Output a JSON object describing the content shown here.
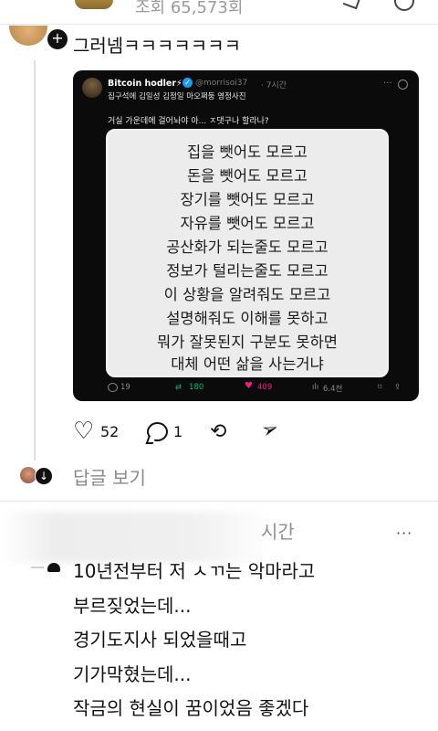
{
  "top": {
    "views": "조회 65,573회"
  },
  "reply1": {
    "text": "그러넴ㅋㅋㅋㅋㅋㅋㅋ",
    "follow_badge": "+",
    "likes": "52",
    "comments": "1",
    "see_replies": "답글 보기",
    "down_badge": "↓"
  },
  "tweet": {
    "name": "Bitcoin hodler⚡",
    "verified": "✓",
    "handle": "@morrisoi37",
    "time": "· 7시간",
    "more": "···",
    "subtitle": "집구석에 김일성 김정일 마오쩌둥 영정사진",
    "body": "거실 가운데에 걸어놔야 아... ㅈ댓구나 할라나?",
    "image_lines": [
      "집을 뺏어도 모르고",
      "돈을 뺏어도 모르고",
      "장기를 뺏어도 모르고",
      "자유를 뺏어도 모르고",
      "공산화가 되는줄도 모르고",
      "정보가 털리는줄도 모르고",
      "이 상황을 알려줘도 모르고",
      "설명해줘도 이해를 못하고",
      "뭐가 잘못된지 구분도 못하면",
      "대체 어떤 삶을 사는거냐"
    ],
    "replies": "19",
    "reposts": "180",
    "likes": "409",
    "views": "6.4천",
    "colors": {
      "repost": "#00ba7c",
      "like": "#f91880",
      "verified": "#1d9bf0"
    }
  },
  "reply2": {
    "time": "시간",
    "more": "···",
    "lines": [
      "10년전부터 저 ㅅㄲ는 악마라고",
      "부르짖었는데...",
      "경기도지사 되었을때고",
      "기가막혔는데...",
      "작금의 현실이 꿈이었음 좋겠다"
    ]
  },
  "icons": {
    "heart": "♡",
    "repost": "⟲",
    "send": "➢",
    "tweet_repost": "⇄",
    "tweet_like": "♥",
    "tweet_views": "ılı",
    "tweet_bookmark": "⌑",
    "tweet_share": "⇪"
  }
}
